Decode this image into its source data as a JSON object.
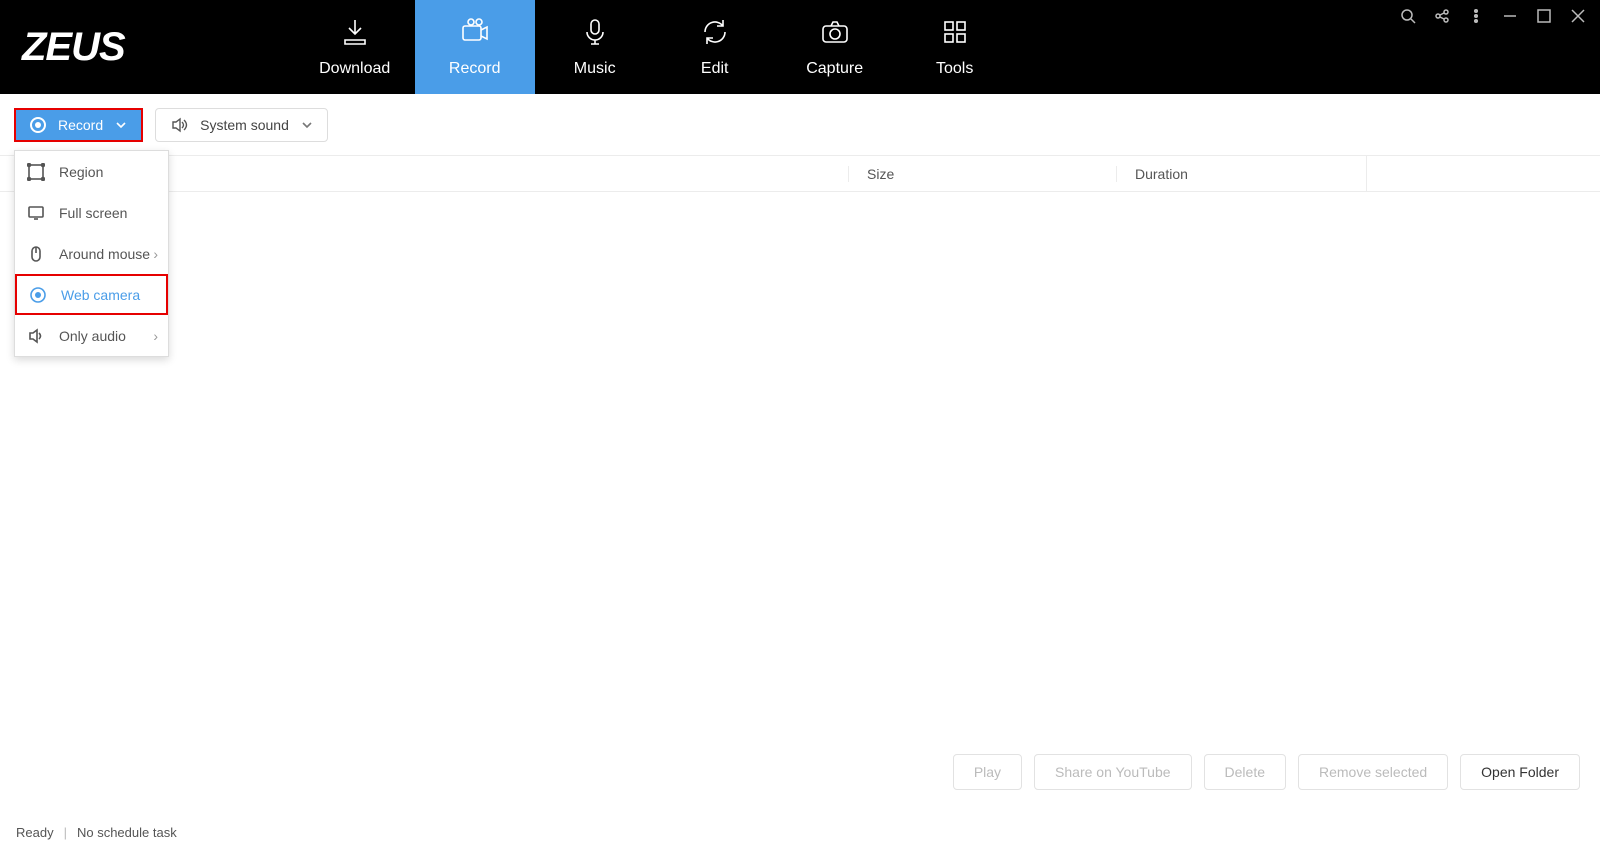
{
  "app": {
    "logo": "ZEUS"
  },
  "nav": {
    "download": "Download",
    "record": "Record",
    "music": "Music",
    "edit": "Edit",
    "capture": "Capture",
    "tools": "Tools"
  },
  "toolbar": {
    "record_label": "Record",
    "sound_label": "System sound"
  },
  "dropdown": {
    "region": "Region",
    "fullscreen": "Full screen",
    "around_mouse": "Around mouse",
    "web_camera": "Web camera",
    "only_audio": "Only audio"
  },
  "columns": {
    "size": "Size",
    "duration": "Duration"
  },
  "buttons": {
    "play": "Play",
    "share_youtube": "Share on YouTube",
    "delete": "Delete",
    "remove_selected": "Remove selected",
    "open_folder": "Open Folder"
  },
  "status": {
    "ready": "Ready",
    "task": "No schedule task"
  }
}
